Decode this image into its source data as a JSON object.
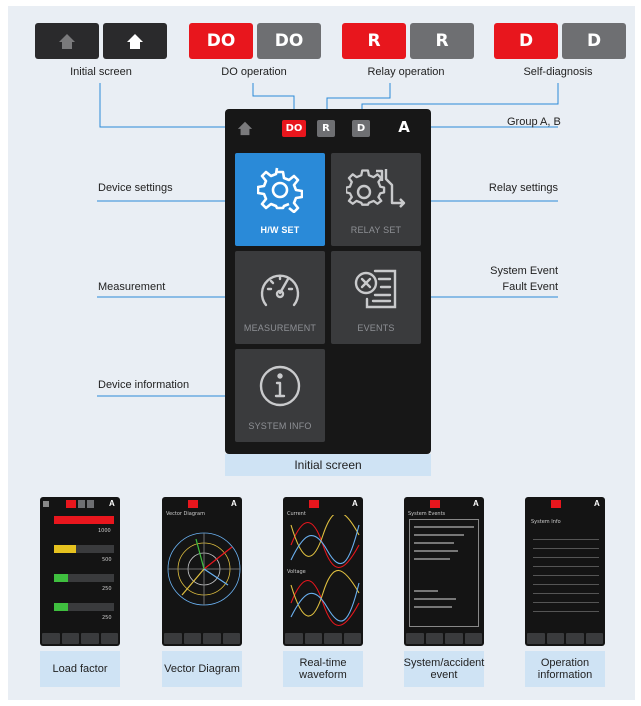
{
  "legend": {
    "initial": {
      "label": "Initial screen"
    },
    "do": {
      "left": "DO",
      "right": "DO",
      "label": "DO operation"
    },
    "relay": {
      "left": "R",
      "right": "R",
      "label": "Relay operation"
    },
    "diag": {
      "left": "D",
      "right": "D",
      "label": "Self-diagnosis"
    }
  },
  "device": {
    "bar": {
      "do": "DO",
      "r": "R",
      "d": "D",
      "group": "A"
    },
    "tiles": [
      {
        "label": "H/W SET",
        "icon": "gear-icon"
      },
      {
        "label": "RELAY SET",
        "icon": "relay-gear-icon"
      },
      {
        "label": "MEASUREMENT",
        "icon": "gauge-icon"
      },
      {
        "label": "EVENTS",
        "icon": "events-list-icon"
      },
      {
        "label": "SYSTEM INFO",
        "icon": "info-icon"
      }
    ],
    "caption": "Initial screen"
  },
  "callouts": {
    "group": "Group A, B",
    "device_settings": "Device settings",
    "relay_settings": "Relay settings",
    "measurement": "Measurement",
    "system_event": "System Event",
    "fault_event": "Fault Event",
    "device_info": "Device information"
  },
  "thumbs": [
    {
      "caption": "Load factor"
    },
    {
      "caption": "Vector Diagram",
      "title": "Vector Diagram"
    },
    {
      "caption_l1": "Real-time",
      "caption_l2": "waveform",
      "title1": "Current",
      "title2": "Voltage"
    },
    {
      "caption_l1": "System/accident",
      "caption_l2": "event",
      "title": "System Events"
    },
    {
      "caption_l1": "Operation",
      "caption_l2": "information",
      "title": "System Info"
    }
  ],
  "load": {
    "r1": "1000",
    "r2": "500",
    "r3": "250",
    "r4": "250"
  },
  "colors": {
    "accent_blue": "#2a8ad8",
    "red": "#e8161d",
    "dark": "#2a2a2c",
    "gray": "#6e6f72",
    "caption_bg": "#cfe3f4",
    "line": "#2a8ad8"
  }
}
